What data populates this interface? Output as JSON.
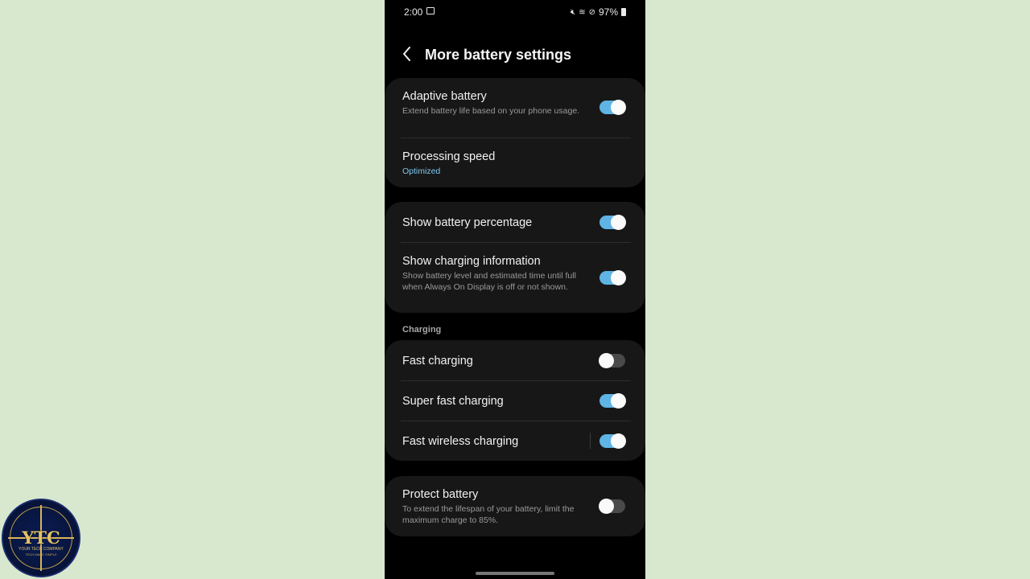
{
  "status": {
    "time": "2:00",
    "battery_pct": "97%",
    "icons": [
      "image-icon",
      "mute-icon",
      "wifi-icon",
      "dnd-icon",
      "battery-icon"
    ]
  },
  "header": {
    "title": "More battery settings",
    "back_icon": "back-chevron-icon"
  },
  "group1": [
    {
      "title": "Adaptive battery",
      "subtitle": "Extend battery life based on your phone usage.",
      "toggle": true
    },
    {
      "title": "Processing speed",
      "subtitle": "Optimized"
    }
  ],
  "group2": [
    {
      "title": "Show battery percentage",
      "toggle": true
    },
    {
      "title": "Show charging information",
      "subtitle": "Show battery level and estimated time until full when Always On Display is off or not shown.",
      "toggle": true
    }
  ],
  "charging": {
    "section_label": "Charging",
    "items": [
      {
        "title": "Fast charging",
        "toggle": false
      },
      {
        "title": "Super fast charging",
        "toggle": true
      },
      {
        "title": "Fast wireless charging",
        "toggle": true
      }
    ]
  },
  "group4": [
    {
      "title": "Protect battery",
      "subtitle": "To extend the lifespan of your battery, limit the maximum charge to 85%.",
      "toggle": false
    }
  ],
  "watermark": {
    "text": "YTC",
    "line1": "YOUR TECH COMPANY",
    "line2": "TECH MADE SIMPLE"
  },
  "colors": {
    "toggle_on": "#5fb4e4",
    "accent_text": "#7fc9f2",
    "background": "#d8e8cf"
  }
}
